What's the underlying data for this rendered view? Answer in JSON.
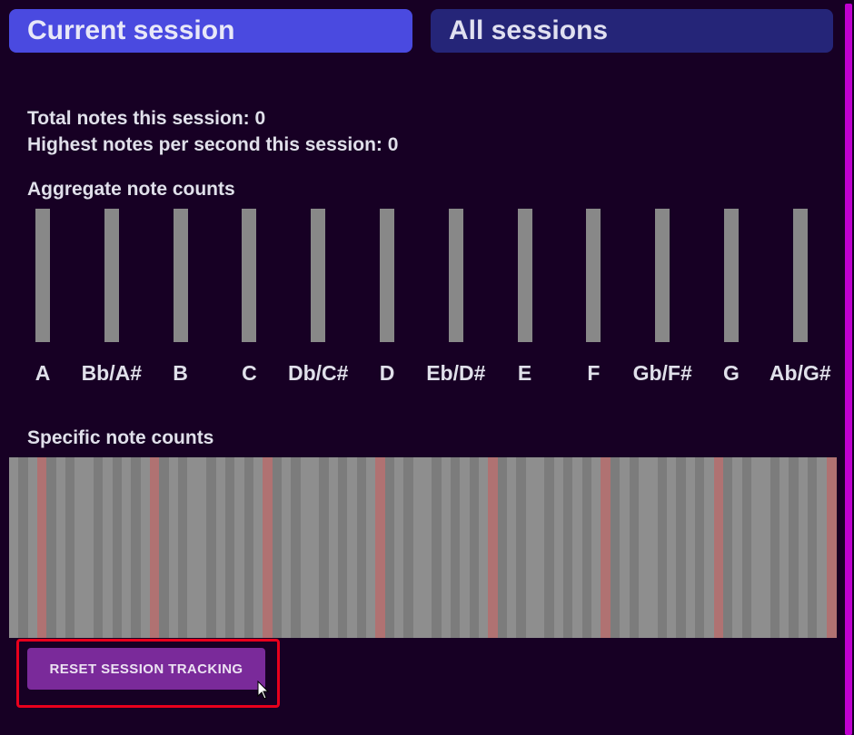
{
  "tabs": {
    "current_session": "Current session",
    "all_sessions": "All sessions"
  },
  "stats": {
    "total_notes": "Total notes this session: 0",
    "highest_nps": "Highest notes per second this session: 0"
  },
  "aggregate": {
    "title": "Aggregate note counts",
    "notes": [
      "A",
      "Bb/A#",
      "B",
      "C",
      "Db/C#",
      "D",
      "Eb/D#",
      "E",
      "F",
      "Gb/F#",
      "G",
      "Ab/G#"
    ],
    "counts": [
      0,
      0,
      0,
      0,
      0,
      0,
      0,
      0,
      0,
      0,
      0,
      0
    ],
    "bar_color": "#888888"
  },
  "specific": {
    "title": "Specific note counts",
    "key_count": 88,
    "counts_all_zero": true,
    "colors": {
      "white_key": "#8e8e8e",
      "black_key": "#7c7c7c",
      "c_key": "#b07272"
    }
  },
  "reset_button": {
    "label": "RESET SESSION TRACKING",
    "color": "#7a2a9a"
  },
  "accent_colors": {
    "tab_active": "#4a4ae0",
    "tab_inactive": "#252578",
    "background": "#170024",
    "scrollbar": "#c000d0",
    "highlight": "#e8001c"
  }
}
